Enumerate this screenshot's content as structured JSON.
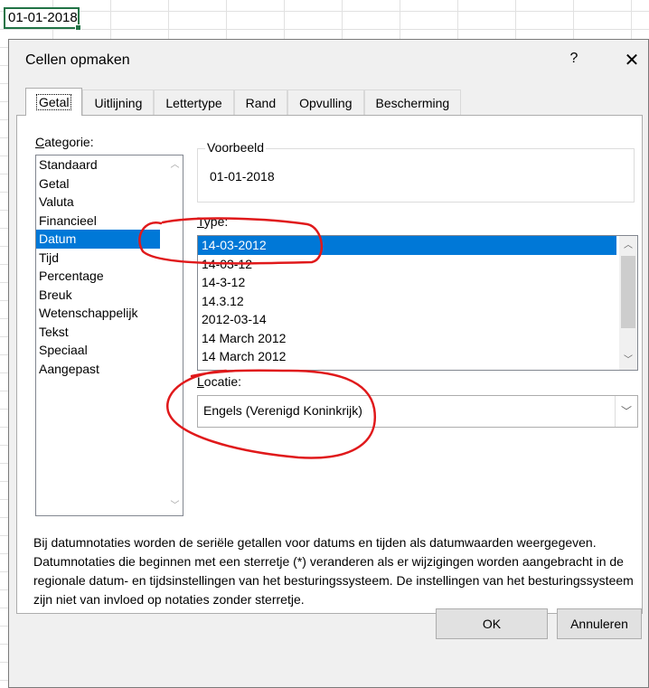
{
  "sheet": {
    "active_cell_value": "01-01-2018"
  },
  "dialog": {
    "title": "Cellen opmaken",
    "help": "?",
    "close": "✕",
    "tabs": [
      {
        "label": "Getal",
        "active": true
      },
      {
        "label": "Uitlijning"
      },
      {
        "label": "Lettertype"
      },
      {
        "label": "Rand"
      },
      {
        "label": "Opvulling"
      },
      {
        "label": "Bescherming"
      }
    ],
    "category": {
      "label_underlined": "C",
      "label_rest": "ategorie:",
      "items": [
        "Standaard",
        "Getal",
        "Valuta",
        "Financieel",
        "Datum",
        "Tijd",
        "Percentage",
        "Breuk",
        "Wetenschappelijk",
        "Tekst",
        "Speciaal",
        "Aangepast"
      ],
      "selected": "Datum"
    },
    "preview": {
      "title": "Voorbeeld",
      "value": "01-01-2018"
    },
    "type": {
      "label_underlined": "T",
      "label_rest": "ype:",
      "items": [
        "14-03-2012",
        "14-03-12",
        "14-3-12",
        "14.3.12",
        "2012-03-14",
        "14 March 2012",
        "14 March 2012"
      ],
      "selected": "14-03-2012"
    },
    "locale": {
      "label_underlined": "L",
      "label_rest": "ocatie:",
      "value": "Engels (Verenigd Koninkrijk)"
    },
    "description": "Bij datumnotaties worden de seriële getallen voor datums en tijden als datumwaarden weergegeven. Datumnotaties die beginnen met een sterretje (*) veranderen als er wijzigingen worden aangebracht in de regionale datum- en tijdsinstellingen van het besturingssysteem. De instellingen van het besturingssysteem zijn niet van invloed op notaties zonder sterretje.",
    "buttons": {
      "ok": "OK",
      "cancel": "Annuleren"
    }
  },
  "colors": {
    "selection": "#0078d7",
    "annotation": "#e0191b",
    "cell_border": "#217346"
  }
}
